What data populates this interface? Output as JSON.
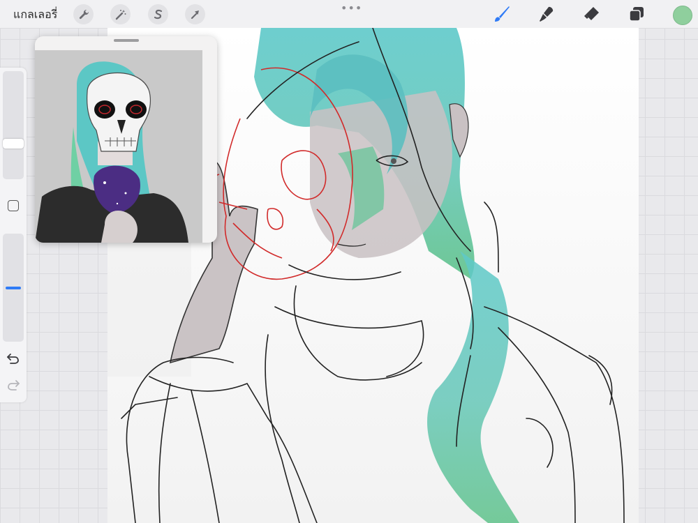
{
  "app": {
    "gallery_label": "แกลเลอรี่"
  },
  "toolbar": {
    "left_tools": [
      {
        "icon": "wrench-icon",
        "name": "actions"
      },
      {
        "icon": "magic-wand-icon",
        "name": "adjustments"
      },
      {
        "icon": "selection-s-icon",
        "name": "selection"
      },
      {
        "icon": "arrow-cursor-icon",
        "name": "transform"
      }
    ],
    "more_label": "•••",
    "right_tools": [
      {
        "icon": "brush-icon",
        "name": "paint"
      },
      {
        "icon": "smudge-icon",
        "name": "smudge"
      },
      {
        "icon": "eraser-icon",
        "name": "erase"
      },
      {
        "icon": "layers-icon",
        "name": "layers"
      }
    ],
    "active_color": "#8fcf9d",
    "accent": "#2f7bf6"
  },
  "sidebar": {
    "brush_size": 0.7,
    "opacity": 0.5,
    "icons": [
      "square-modify-icon",
      "undo-icon",
      "redo-icon"
    ]
  }
}
